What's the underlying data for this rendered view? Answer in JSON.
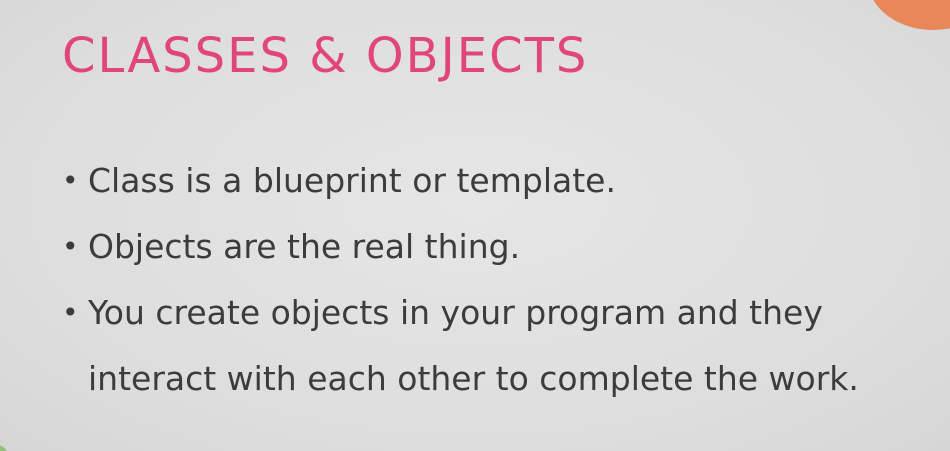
{
  "slide": {
    "title": "CLASSES & OBJECTS",
    "bullets": [
      "Class is a blueprint or template.",
      "Objects are the real thing.",
      "You create objects in your program and they interact with each other to complete the work."
    ],
    "bullet_symbol": "•"
  },
  "colors": {
    "title": "#e0457b",
    "text": "#3c3c3c",
    "background": "#dedede",
    "corner_accent": "#e8875a",
    "corner_accent_left": "#8fc27a"
  }
}
